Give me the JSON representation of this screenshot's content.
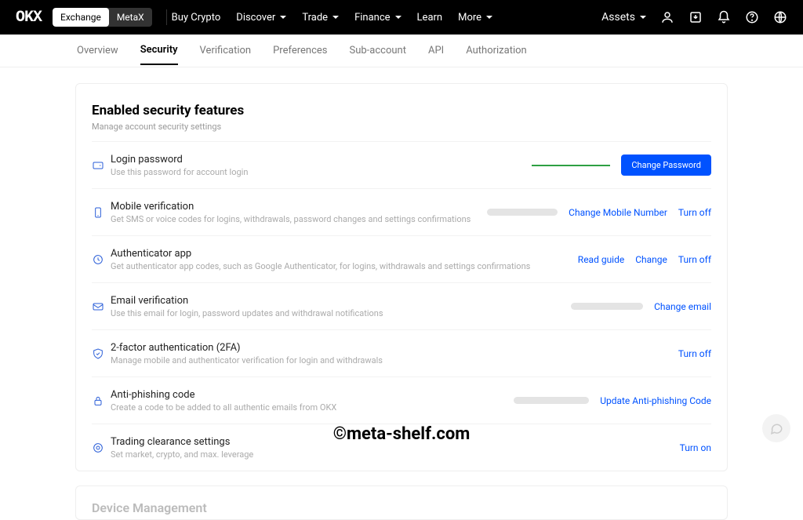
{
  "topnav": {
    "logo": "OKX",
    "mode_exchange": "Exchange",
    "mode_metax": "MetaX",
    "links": [
      "Buy Crypto",
      "Discover",
      "Trade",
      "Finance",
      "Learn",
      "More"
    ],
    "link_has_chevron": [
      false,
      true,
      true,
      true,
      false,
      true
    ],
    "assets": "Assets"
  },
  "subnav": {
    "tabs": [
      "Overview",
      "Security",
      "Verification",
      "Preferences",
      "Sub-account",
      "API",
      "Authorization"
    ],
    "active_index": 1
  },
  "card": {
    "title": "Enabled security features",
    "subtitle": "Manage account security settings"
  },
  "rows": {
    "login_password": {
      "title": "Login password",
      "desc": "Use this password for account login",
      "button": "Change Password"
    },
    "mobile": {
      "title": "Mobile verification",
      "desc": "Get SMS or voice codes for logins, withdrawals, password changes and settings confirmations",
      "change": "Change Mobile Number",
      "turnoff": "Turn off"
    },
    "authenticator": {
      "title": "Authenticator app",
      "desc": "Get authenticator app codes, such as Google Authenticator, for logins, withdrawals and settings confirmations",
      "read": "Read guide",
      "change": "Change",
      "turnoff": "Turn off"
    },
    "email": {
      "title": "Email verification",
      "desc": "Use this email for login, password updates and withdrawal notifications",
      "change": "Change email"
    },
    "twofa": {
      "title": "2-factor authentication (2FA)",
      "desc": "Manage mobile and authenticator verification for login and withdrawals",
      "turnoff": "Turn off"
    },
    "antiphish": {
      "title": "Anti-phishing code",
      "desc": "Create a code to be added to all authentic emails from OKX",
      "update": "Update Anti-phishing Code"
    },
    "trading": {
      "title": "Trading clearance settings",
      "desc": "Set market, crypto, and max. leverage",
      "turnon": "Turn on"
    }
  },
  "section2": {
    "title": "Device Management"
  },
  "watermark": "©meta-shelf.com"
}
